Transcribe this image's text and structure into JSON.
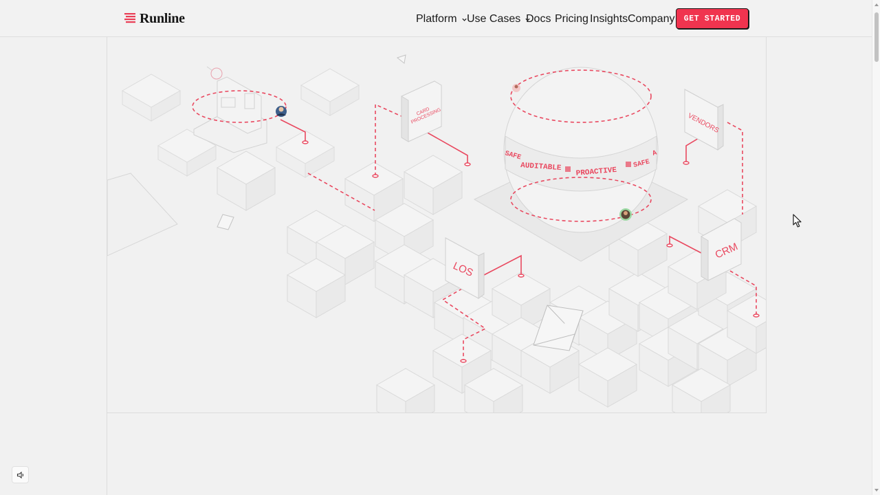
{
  "brand": {
    "name": "Runline",
    "accent": "#f0344f"
  },
  "nav": {
    "items": [
      {
        "label": "Platform",
        "dropdown": true
      },
      {
        "label": "Use Cases",
        "dropdown": true
      },
      {
        "label": "Docs",
        "dropdown": false
      },
      {
        "label": "Pricing",
        "dropdown": false
      },
      {
        "label": "Insights",
        "dropdown": false
      },
      {
        "label": "Company",
        "dropdown": false
      }
    ],
    "cta_label": "GET STARTED"
  },
  "hero": {
    "signs": {
      "card_processing_line1": "CARD",
      "card_processing_line2": "PROCESSING",
      "vendors": "VENDORS",
      "crm": "CRM",
      "los": "LOS"
    },
    "sphere_band": {
      "words": [
        "SAFE",
        "AUDITABLE",
        "PROACTIVE",
        "SAFE",
        "A"
      ]
    }
  },
  "controls": {
    "sound_icon": "speaker-icon"
  }
}
